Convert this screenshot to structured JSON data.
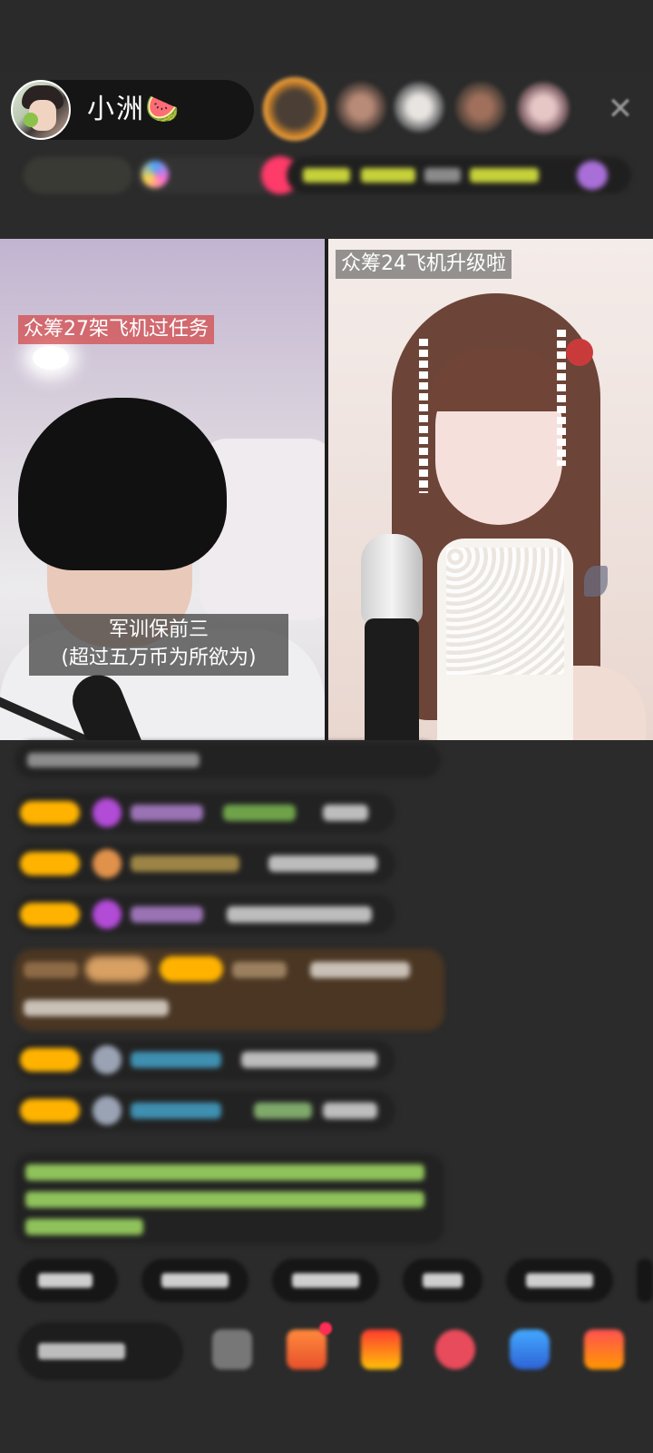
{
  "header": {
    "host_name": "小洲🍉",
    "close_label": "✕"
  },
  "video": {
    "left_banner": "众筹27架飞机过任务",
    "left_caption_line1": "军训保前三",
    "left_caption_line2": "(超过五万币为所欲为)",
    "right_banner": "众筹24飞机升级啦"
  }
}
